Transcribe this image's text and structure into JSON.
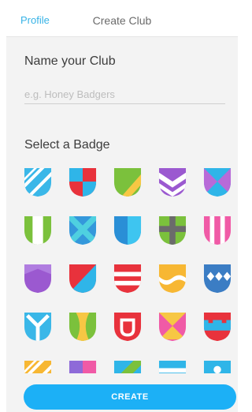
{
  "nav": {
    "back_label": "Profile",
    "title": "Create Club"
  },
  "form": {
    "name_heading": "Name your Club",
    "name_placeholder": "e.g. Honey Badgers",
    "name_value": "",
    "badge_heading": "Select a Badge"
  },
  "badges": [
    {
      "icon": "diagonal-stripes-icon",
      "colors": [
        "#3ab7e8",
        "#ffffff"
      ]
    },
    {
      "icon": "quarters-icon",
      "colors": [
        "#e8323c",
        "#2fb5e8"
      ]
    },
    {
      "icon": "diagonal-band-icon",
      "colors": [
        "#7bc13c",
        "#f7c744"
      ]
    },
    {
      "icon": "chevrons-icon",
      "colors": [
        "#9b59d0",
        "#ffffff"
      ]
    },
    {
      "icon": "saltire-triangles-icon",
      "colors": [
        "#2fb5e8",
        "#b86ad8"
      ]
    },
    {
      "icon": "pale-icon",
      "colors": [
        "#7bc13c",
        "#ffffff"
      ]
    },
    {
      "icon": "saltire-icon",
      "colors": [
        "#3498db",
        "#4fd0e0"
      ]
    },
    {
      "icon": "split-vertical-icon",
      "colors": [
        "#2a8fd6",
        "#3ec5f0"
      ]
    },
    {
      "icon": "cross-icon",
      "colors": [
        "#7bc13c",
        "#6b6b6b"
      ]
    },
    {
      "icon": "pallets-icon",
      "colors": [
        "#f05aa6",
        "#ffffff"
      ]
    },
    {
      "icon": "chief-icon",
      "colors": [
        "#9b59d0",
        "#b07de0"
      ]
    },
    {
      "icon": "bend-split-icon",
      "colors": [
        "#e8323c",
        "#2fb5e8"
      ]
    },
    {
      "icon": "bars-icon",
      "colors": [
        "#e8323c",
        "#ffffff"
      ]
    },
    {
      "icon": "wave-icon",
      "colors": [
        "#f7b733",
        "#ffffff"
      ]
    },
    {
      "icon": "diamonds-icon",
      "colors": [
        "#3b7dc4",
        "#ffffff"
      ]
    },
    {
      "icon": "pall-icon",
      "colors": [
        "#3ab7e8",
        "#ffffff"
      ]
    },
    {
      "icon": "flanches-icon",
      "colors": [
        "#7bc13c",
        "#f7c744"
      ]
    },
    {
      "icon": "arch-icon",
      "colors": [
        "#e8323c",
        "#ffffff"
      ]
    },
    {
      "icon": "hourglass-icon",
      "colors": [
        "#f05aa6",
        "#f7c744"
      ]
    },
    {
      "icon": "battlement-icon",
      "colors": [
        "#e8323c",
        "#2fb5e8"
      ]
    },
    {
      "icon": "diagonal-stripes-icon",
      "colors": [
        "#f7b733",
        "#ffffff"
      ]
    },
    {
      "icon": "checker-icon",
      "colors": [
        "#8e6ad8",
        "#f05aa6"
      ]
    },
    {
      "icon": "bend-icon",
      "colors": [
        "#2fb5e8",
        "#7bc13c"
      ]
    },
    {
      "icon": "bars-icon",
      "colors": [
        "#2fb5e8",
        "#ffffff"
      ]
    },
    {
      "icon": "three-dots-icon",
      "colors": [
        "#2fb5e8",
        "#ffffff"
      ]
    }
  ],
  "footer": {
    "create_label": "CREATE"
  }
}
